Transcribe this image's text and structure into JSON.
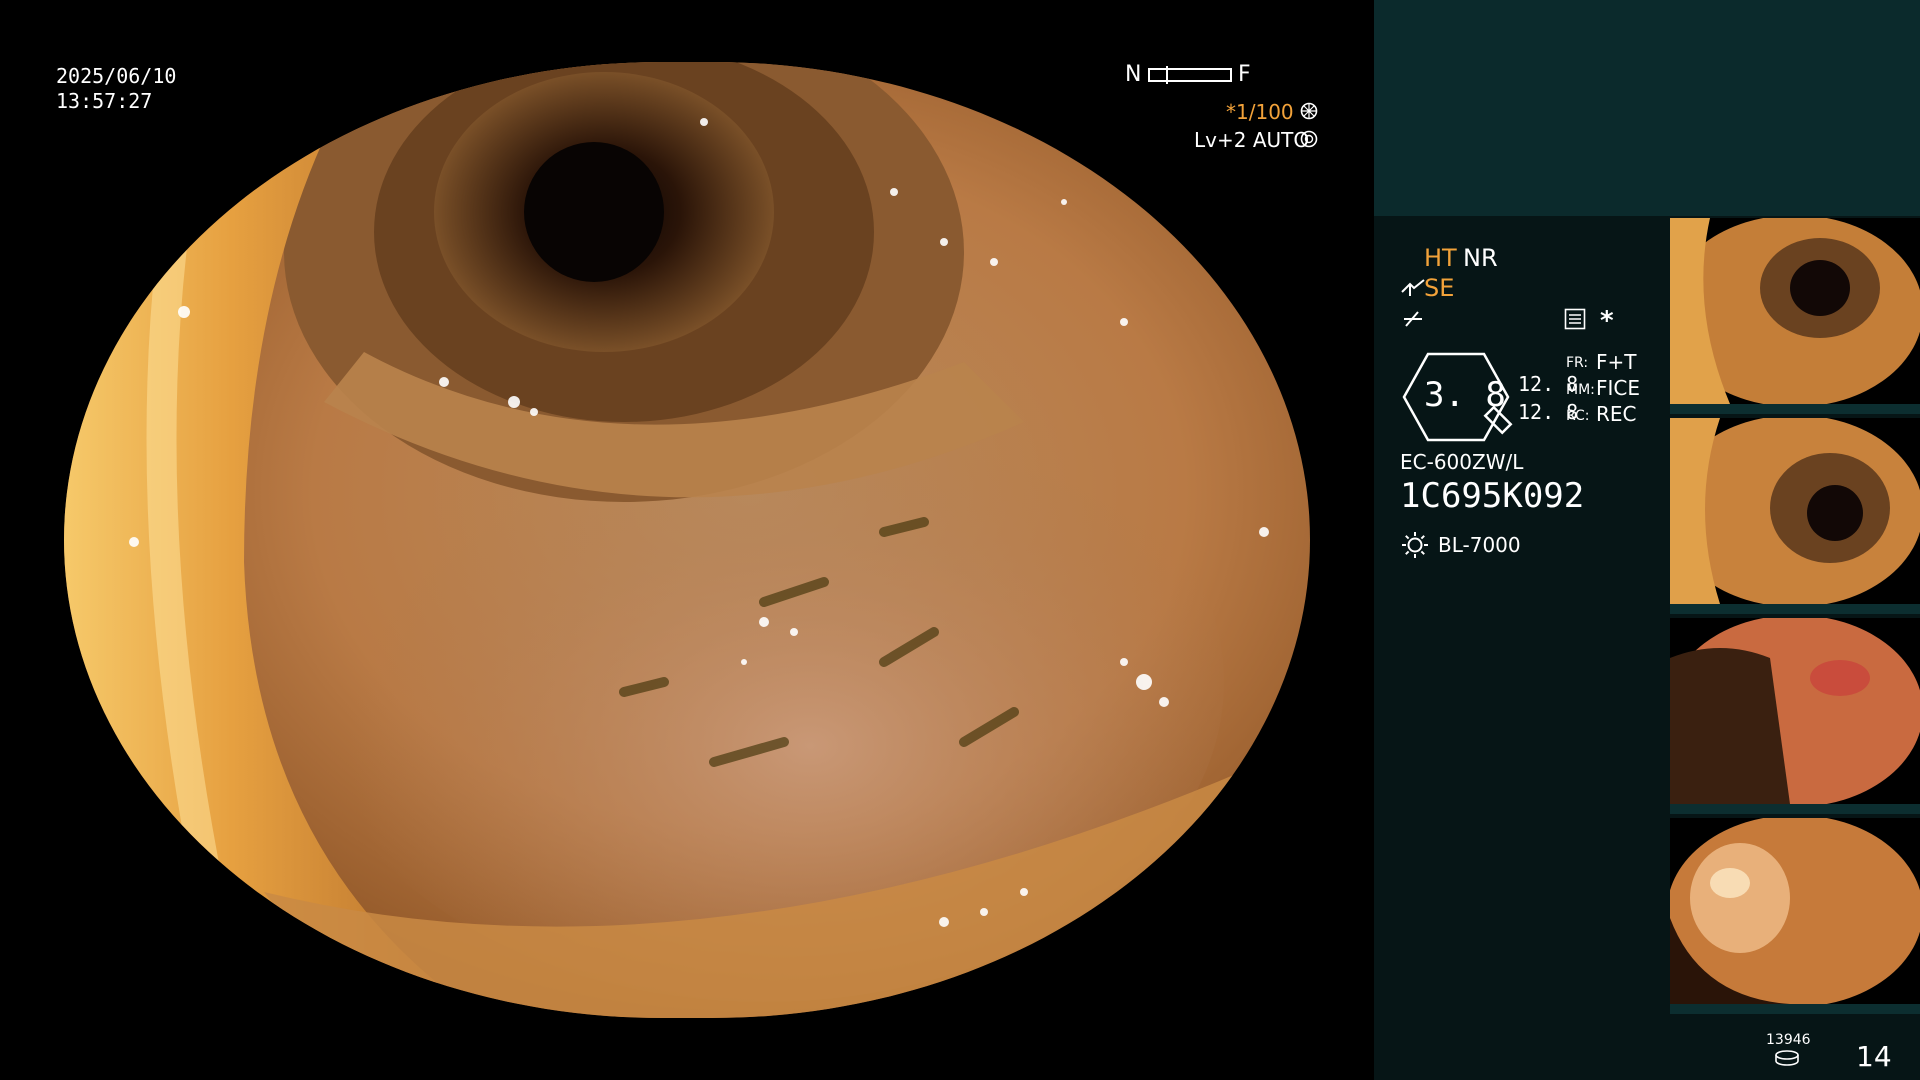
{
  "overlay": {
    "date": "2025/06/10",
    "time": "13:57:27",
    "focus_near": "N",
    "focus_far": "F",
    "shutter": "*1/100",
    "iris_mode": "Lv+2 AUTO"
  },
  "panel": {
    "ht": "HT",
    "nr": "NR",
    "se": "SE",
    "zoom_value": "3. 8",
    "fr_value_1": "12. 8",
    "fr_value_2": "12. 8",
    "fr_label": "FR:",
    "fr_mode": "F+T",
    "mm_label": "MM:",
    "mm_mode": "FICE",
    "rc_label": "RC:",
    "rc_mode": "REC",
    "asterisk": "*",
    "scope_model": "EC-600ZW/L",
    "scope_serial": "1C695K092",
    "light_source": "BL-7000",
    "storage_count": "13946",
    "image_count": "14"
  },
  "colors": {
    "panel_bg": "#061516",
    "panel_top": "#0b2a2c",
    "accent_yellow": "#f2a23a",
    "tissue": "#c0763a"
  },
  "thumbnails": [
    {
      "name": "capture-1"
    },
    {
      "name": "capture-2"
    },
    {
      "name": "capture-3"
    },
    {
      "name": "capture-4"
    }
  ]
}
